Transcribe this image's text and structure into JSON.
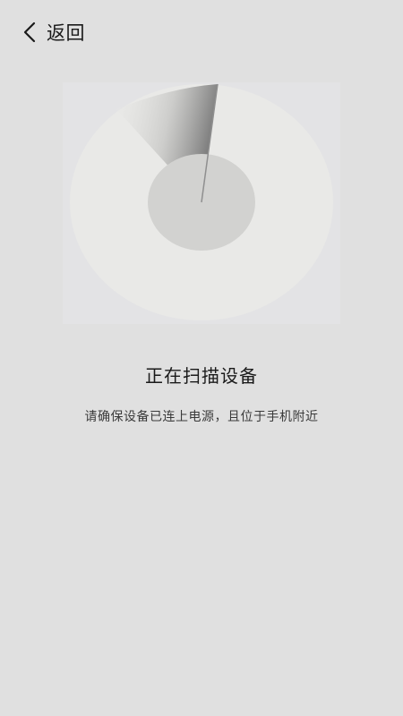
{
  "header": {
    "back_label": "返回",
    "back_icon": "chevron-left-icon"
  },
  "scan": {
    "title": "正在扫描设备",
    "subtitle": "请确保设备已连上电源，且位于手机附近"
  },
  "colors": {
    "background": "#e0e0e0",
    "radar_outer": "#e9e9e7",
    "radar_inner": "#d2d2d0",
    "text_primary": "#1a1a1a",
    "text_secondary": "#3a3a3a"
  }
}
